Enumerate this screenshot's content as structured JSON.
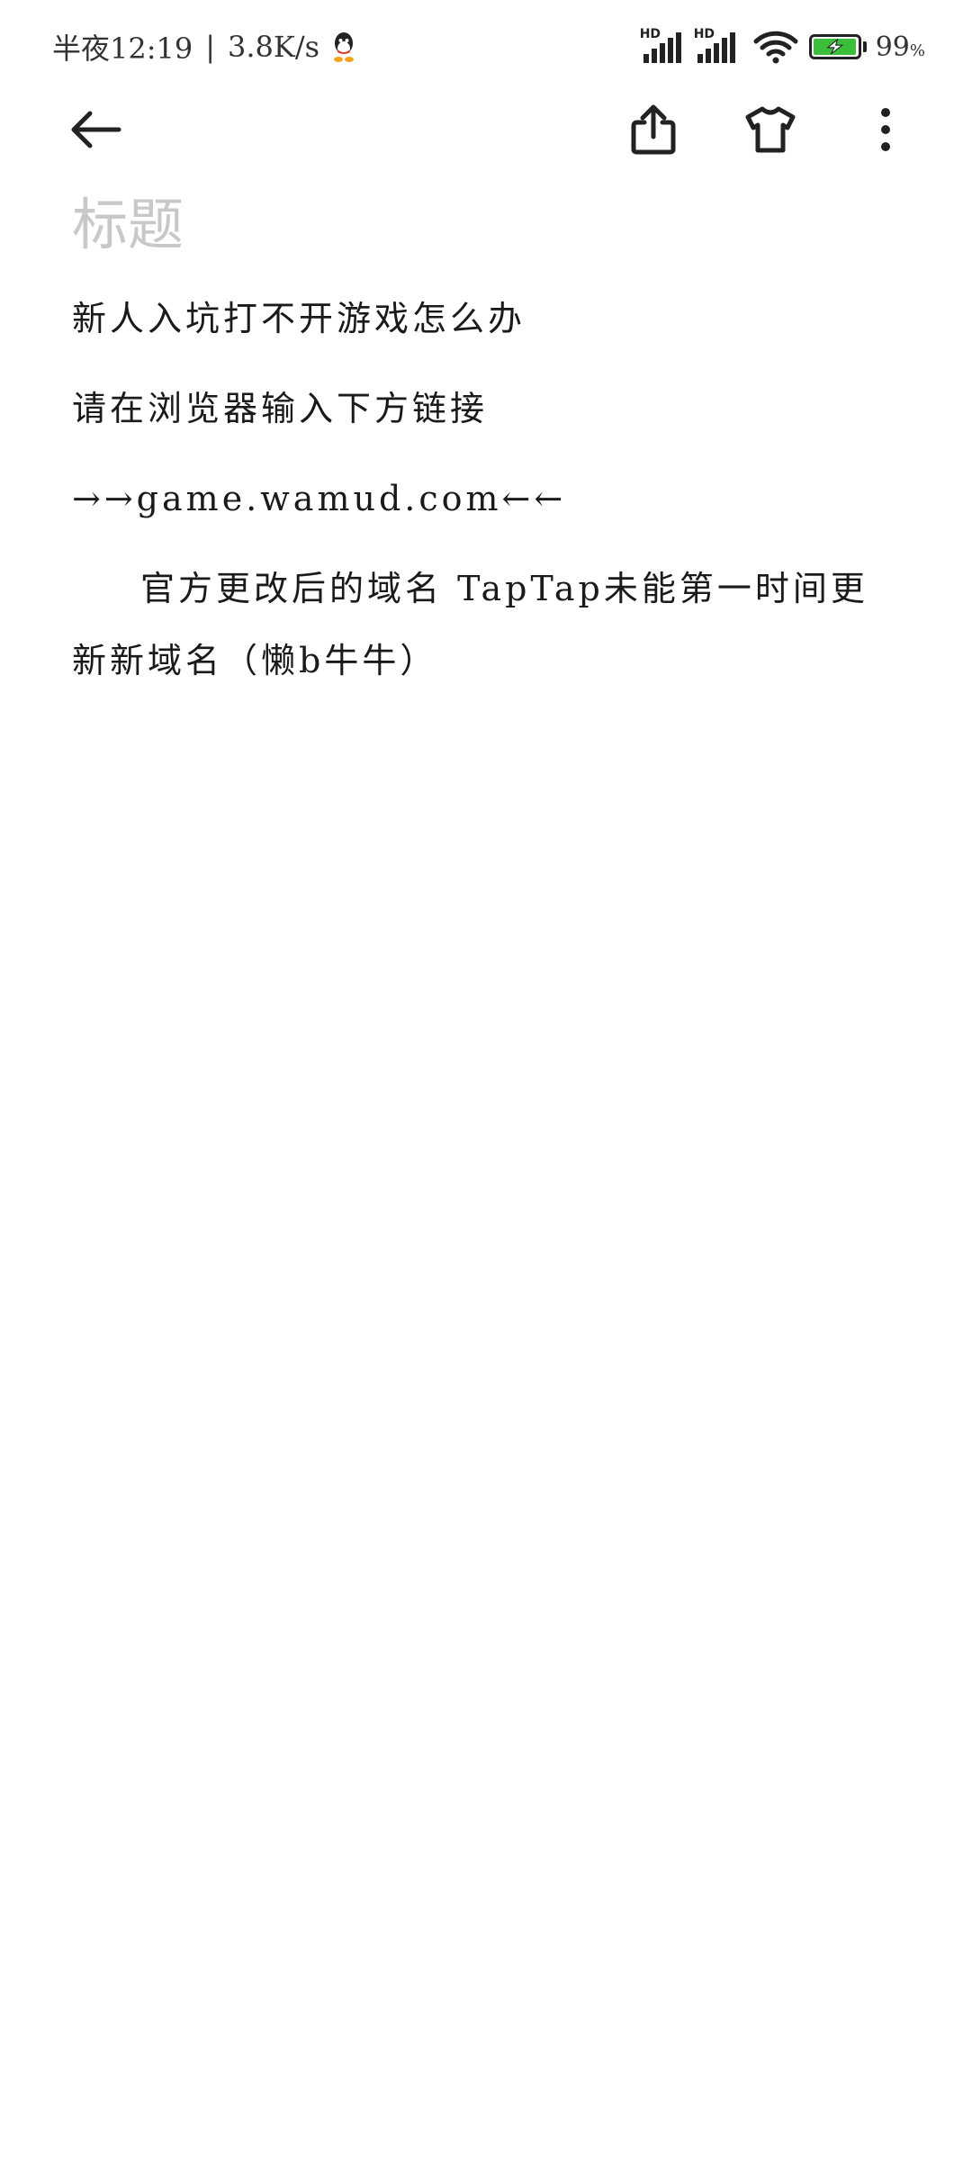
{
  "status_bar": {
    "time": "半夜12:19",
    "separator": "|",
    "net_speed": "3.8K/s",
    "signal_label_1": "HD",
    "signal_label_2": "HD",
    "battery_percent": "99",
    "battery_unit": "%",
    "battery_level": 0.99,
    "icons": [
      "qq-icon",
      "signal-icon",
      "signal-icon",
      "wifi-icon",
      "battery-charging-icon"
    ]
  },
  "toolbar": {
    "icons": [
      "back-arrow-icon",
      "share-icon",
      "tshirt-icon",
      "more-vertical-icon"
    ]
  },
  "note": {
    "title_placeholder": "标题",
    "paragraphs": [
      "新人入坑打不开游戏怎么办",
      "请在浏览器输入下方链接",
      "→→game.wamud.com←←",
      "官方更改后的域名 TapTap未能第一时间更新新域名（懒b牛牛）"
    ]
  },
  "colors": {
    "text": "#1a1a1a",
    "placeholder": "#c8c8c8",
    "icon": "#222222",
    "battery_fill": "#3bbf3b",
    "background": "#ffffff"
  }
}
